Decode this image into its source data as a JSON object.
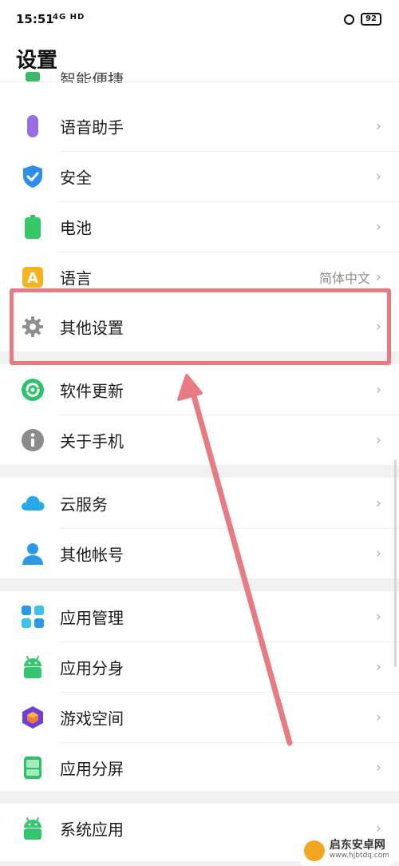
{
  "status_bar": {
    "time": "15:51",
    "signal_text": "4G HD",
    "battery": "92"
  },
  "header": {
    "title": "设置"
  },
  "partial_item": {
    "label": "智能便捷"
  },
  "items": [
    {
      "label": "语音助手",
      "icon": "microphone-icon"
    },
    {
      "label": "安全",
      "icon": "shield-icon"
    },
    {
      "label": "电池",
      "icon": "battery-icon"
    },
    {
      "label": "语言",
      "icon": "language-icon",
      "value": "简体中文"
    },
    {
      "label": "其他设置",
      "icon": "gear-icon"
    },
    {
      "label": "软件更新",
      "icon": "update-icon"
    },
    {
      "label": "关于手机",
      "icon": "info-icon"
    },
    {
      "label": "云服务",
      "icon": "cloud-icon"
    },
    {
      "label": "其他帐号",
      "icon": "account-icon"
    },
    {
      "label": "应用管理",
      "icon": "app-grid-icon"
    },
    {
      "label": "应用分身",
      "icon": "android-icon"
    },
    {
      "label": "游戏空间",
      "icon": "game-cube-icon"
    },
    {
      "label": "应用分屏",
      "icon": "split-screen-icon"
    },
    {
      "label": "系统应用",
      "icon": "android-icon"
    }
  ],
  "chevron": "›",
  "annotation": {
    "color": "#e77a82"
  },
  "watermark": {
    "title": "启东安卓网",
    "subtitle": "www.hjbtdq.com"
  }
}
